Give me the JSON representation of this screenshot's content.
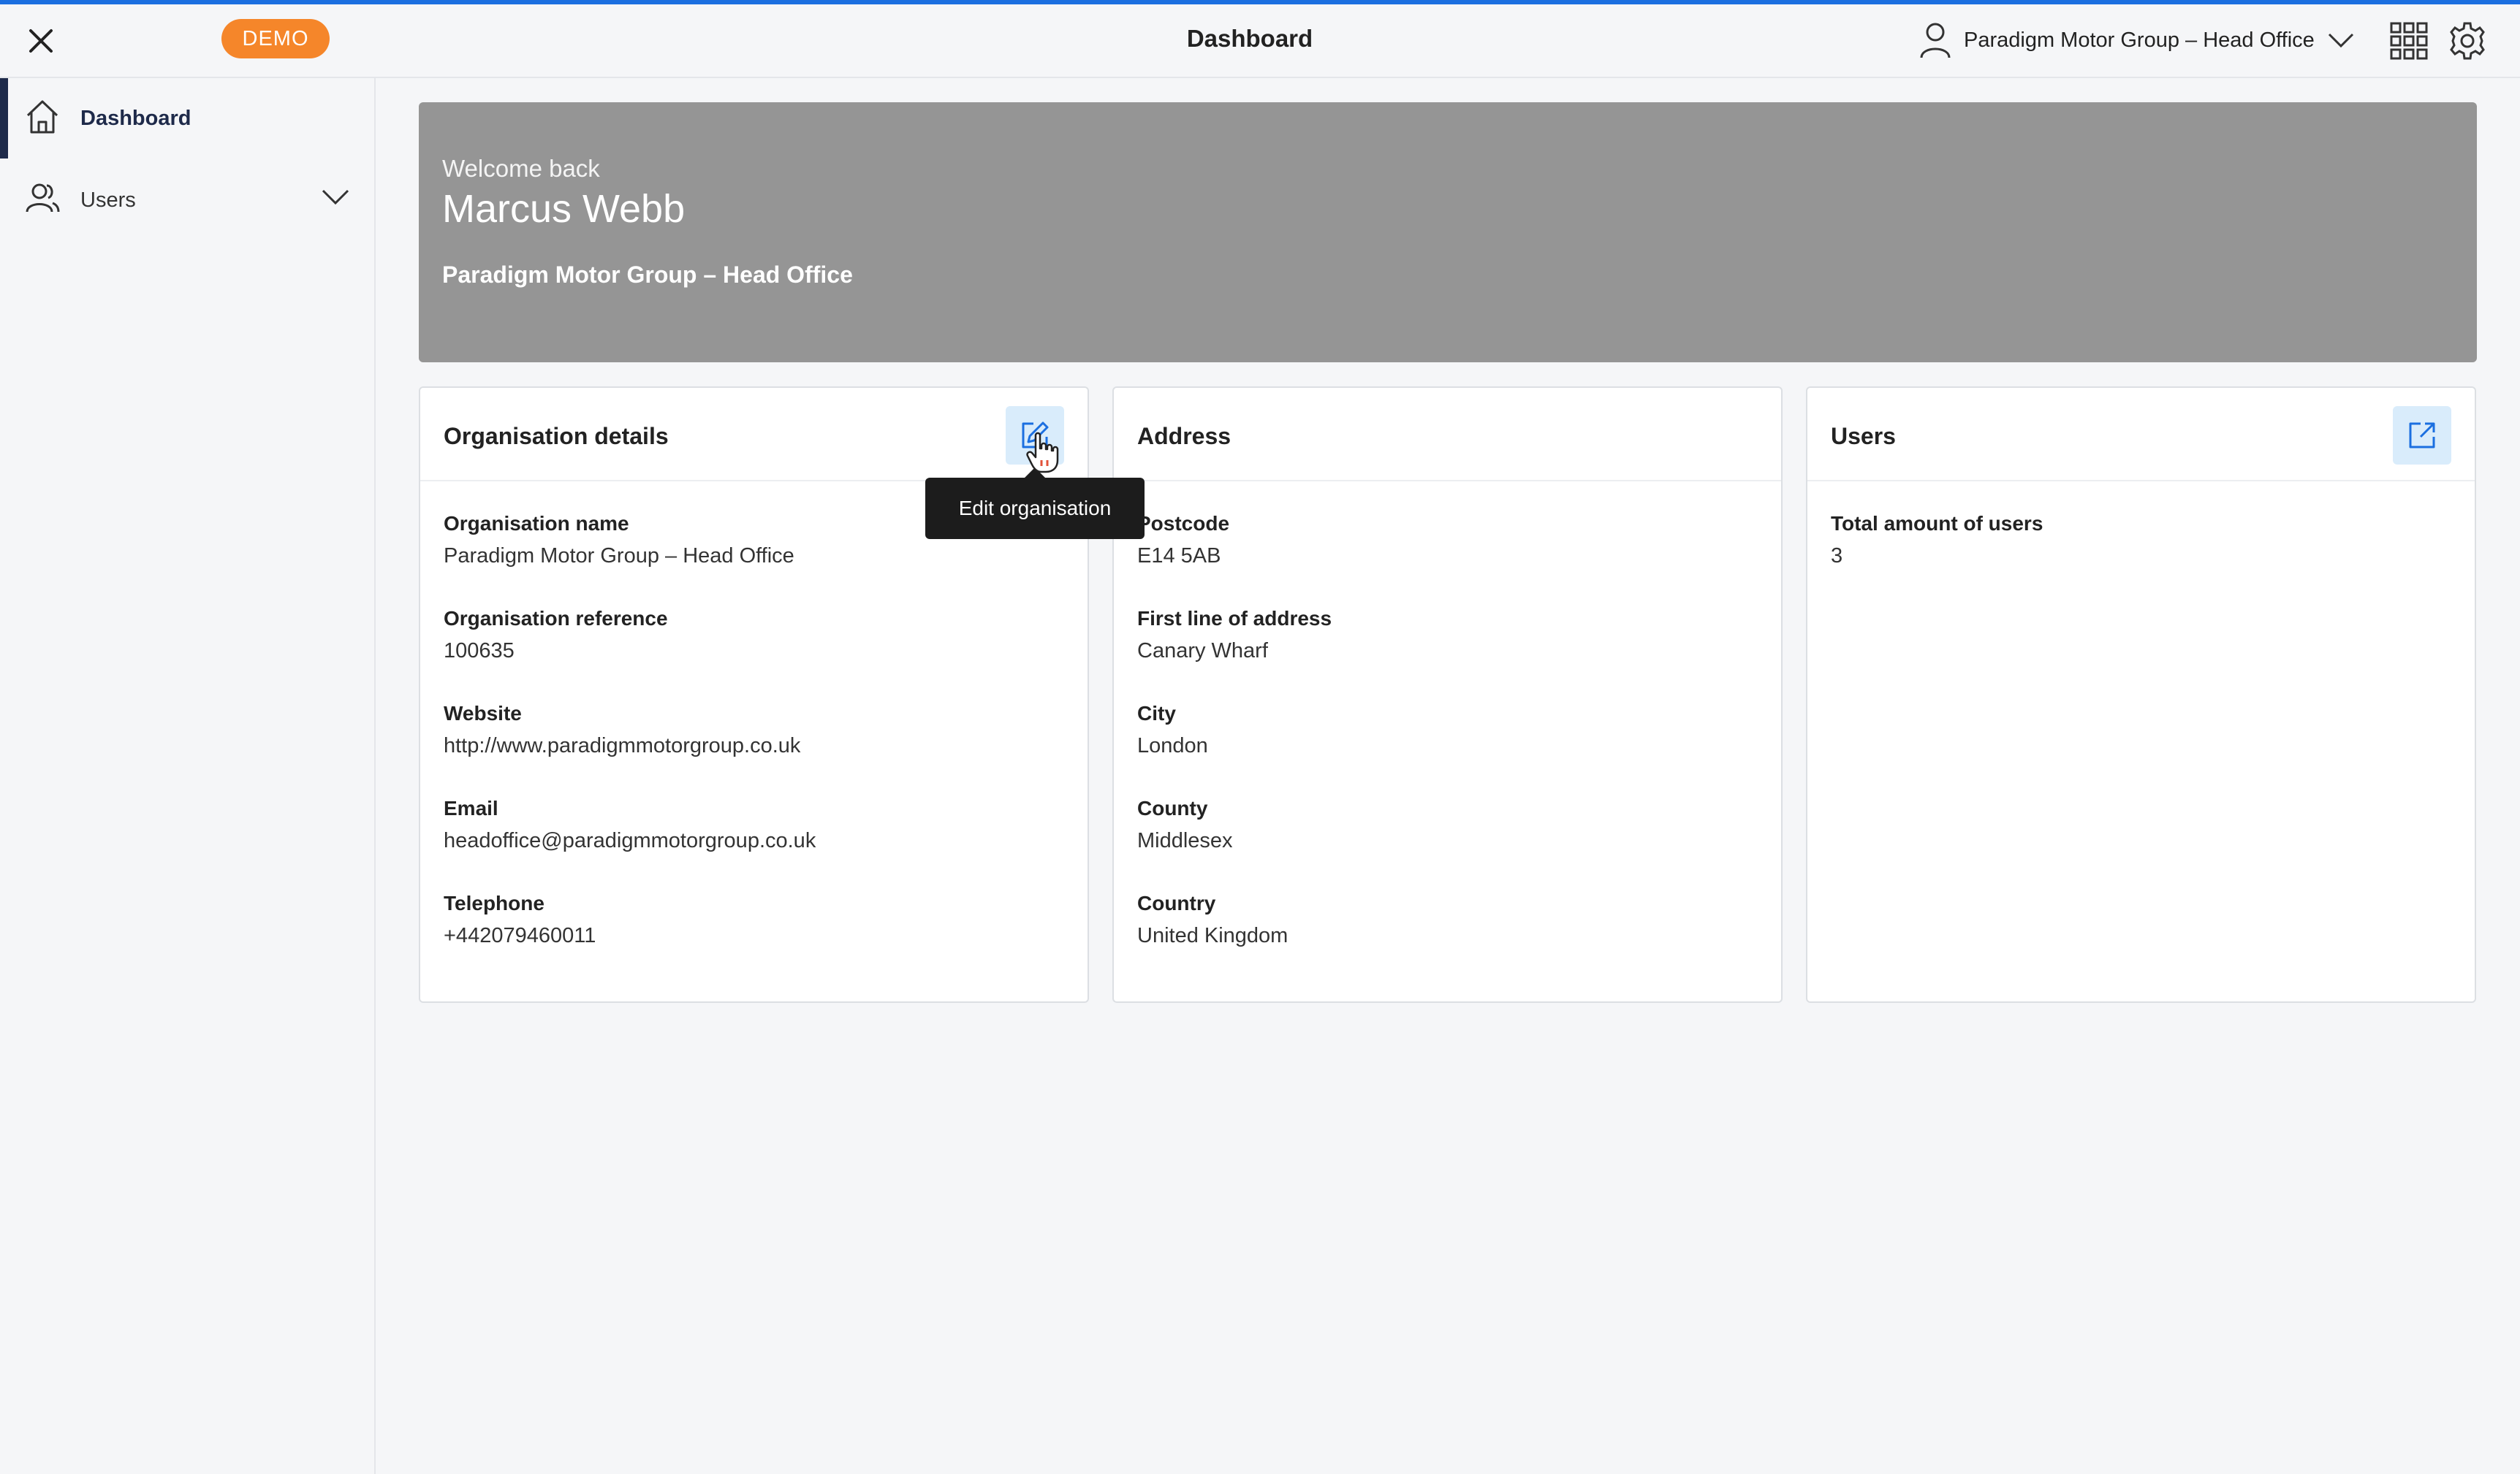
{
  "header": {
    "demo_badge": "DEMO",
    "title": "Dashboard",
    "org_switcher": "Paradigm Motor Group – Head Office",
    "accent_color": "#1b6fe0",
    "badge_color": "#f5862a"
  },
  "sidebar": {
    "items": [
      {
        "label": "Dashboard",
        "icon": "home-icon",
        "active": true
      },
      {
        "label": "Users",
        "icon": "users-icon",
        "expandable": true
      }
    ]
  },
  "banner": {
    "welcome": "Welcome back",
    "name": "Marcus Webb",
    "organisation": "Paradigm Motor Group – Head Office"
  },
  "org_card": {
    "title": "Organisation details",
    "fields": [
      {
        "label": "Organisation name",
        "value": "Paradigm Motor Group – Head Office"
      },
      {
        "label": "Organisation reference",
        "value": "100635"
      },
      {
        "label": "Website",
        "value": "http://www.paradigmmotorgroup.co.uk"
      },
      {
        "label": "Email",
        "value": "headoffice@paradigmmotorgroup.co.uk"
      },
      {
        "label": "Telephone",
        "value": "+442079460011"
      }
    ],
    "tooltip": "Edit organisation"
  },
  "address_card": {
    "title": "Address",
    "fields": [
      {
        "label": "Postcode",
        "value": "E14 5AB"
      },
      {
        "label": "First line of address",
        "value": "Canary Wharf"
      },
      {
        "label": "City",
        "value": "London"
      },
      {
        "label": "County",
        "value": "Middlesex"
      },
      {
        "label": "Country",
        "value": "United Kingdom"
      }
    ]
  },
  "users_card": {
    "title": "Users",
    "fields": [
      {
        "label": "Total amount of users",
        "value": "3"
      }
    ]
  }
}
